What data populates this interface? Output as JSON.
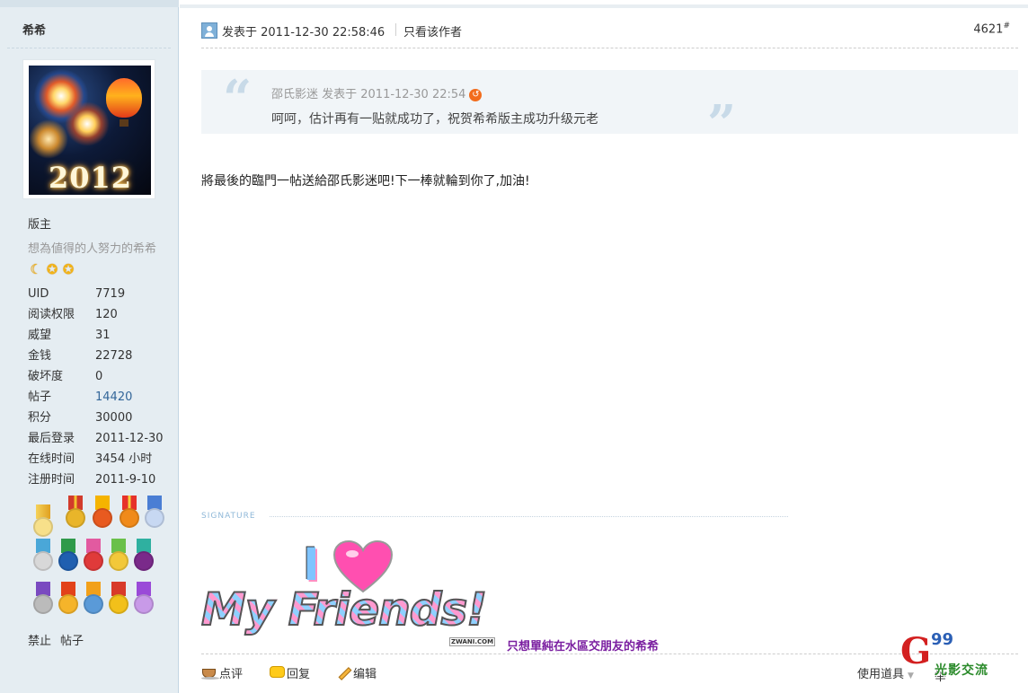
{
  "author": {
    "name": "希希",
    "rank": "版主",
    "custom_title": "想為値得的人努力的希希",
    "avatar_text": "2012",
    "stats": [
      {
        "label": "UID",
        "value": "7719"
      },
      {
        "label": "阅读权限",
        "value": "120"
      },
      {
        "label": "威望",
        "value": "31"
      },
      {
        "label": "金钱",
        "value": "22728"
      },
      {
        "label": "破坏度",
        "value": "0"
      },
      {
        "label": "帖子",
        "value": "14420"
      },
      {
        "label": "积分",
        "value": "30000"
      },
      {
        "label": "最后登录",
        "value": "2011-12-30"
      },
      {
        "label": "在线时间",
        "value": "3454 小时"
      },
      {
        "label": "注册时间",
        "value": "2011-9-10"
      }
    ],
    "actions": {
      "ban": "禁止",
      "posts": "帖子"
    }
  },
  "post": {
    "time": "发表于 2011-12-30 22:58:46",
    "only_author": "只看该作者",
    "floor": "4621",
    "floor_mark": "#",
    "quote": {
      "meta": "邵氏影迷 发表于 2011-12-30 22:54",
      "text": "呵呵，估计再有一贴就成功了，祝贺希希版主成功升级元老"
    },
    "message": "將最後的臨門一帖送給邵氏影迷吧!下一棒就輪到你了,加油!",
    "signature_label": "SIGNATURE",
    "signature_image": {
      "line1": "I",
      "line2": "My Friends!",
      "brand": "ZWANI.COM"
    },
    "signature_caption": "只想單純在水區交朋友的希希"
  },
  "footer": {
    "rate": "点评",
    "reply": "回复",
    "edit": "编辑",
    "use_tools": "使用道具",
    "behind": "举"
  },
  "watermark": {
    "g": "G",
    "num": "99",
    "text": "光影交流"
  },
  "colors": {
    "sidebar_bg": "#e5edf2",
    "link": "#336699",
    "caption": "#7a1ea0",
    "quote_bg": "#f1f5f8"
  }
}
